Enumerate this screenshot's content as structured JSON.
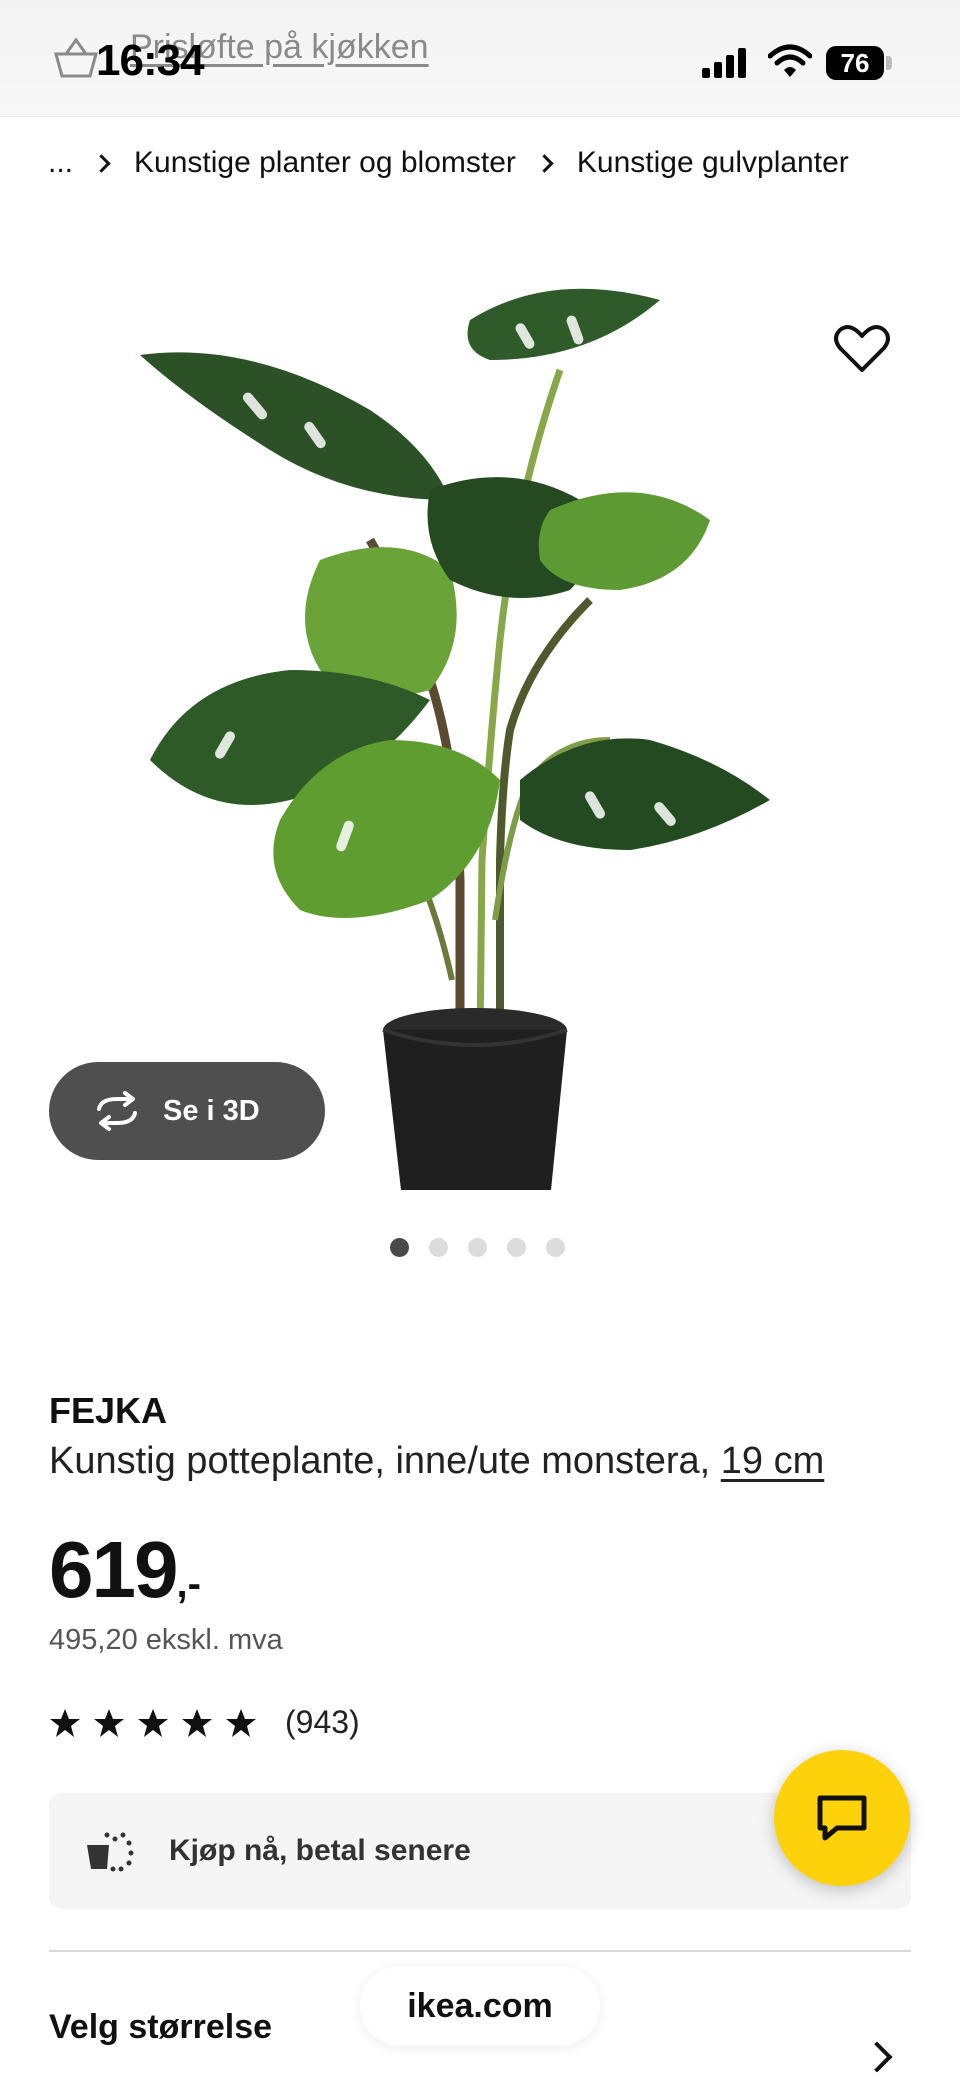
{
  "status_bar": {
    "time": "16:34",
    "battery": "76",
    "banner_link": "Prisløfte på kjøkken"
  },
  "breadcrumb": {
    "ellipsis": "...",
    "items": [
      "Kunstige planter og blomster",
      "Kunstige gulvplanter"
    ]
  },
  "gallery": {
    "view_3d_label": "Se i 3D",
    "image_count": 5,
    "active_index": 0
  },
  "product": {
    "name": "FEJKA",
    "description": "Kunstig potteplante, inne/ute monstera, ",
    "size_link": "19 cm",
    "price": "619",
    "price_suffix": ",-",
    "price_ex_vat": "495,20 ekskl. mva",
    "rating_stars": 5,
    "rating_count": "(943)"
  },
  "payment": {
    "label": "Kjøp nå, betal senere"
  },
  "size_section": {
    "title": "Velg størrelse"
  },
  "browser": {
    "url": "ikea.com"
  },
  "colors": {
    "chat": "#fdd20a",
    "button_3d": "#4f4f4f"
  }
}
